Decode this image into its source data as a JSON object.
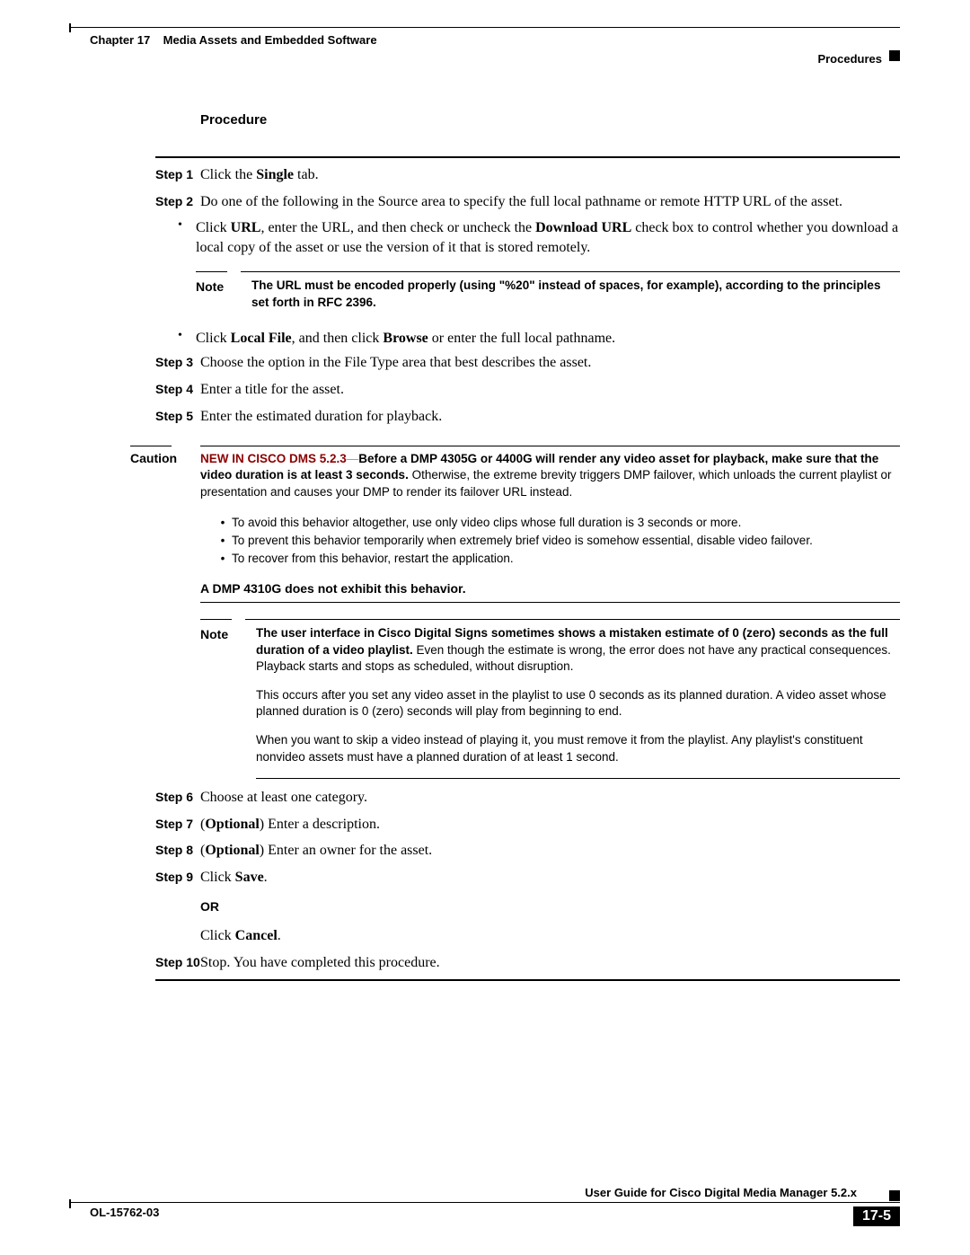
{
  "header": {
    "chapter": "Chapter 17",
    "title": "Media Assets and Embedded Software",
    "section": "Procedures"
  },
  "procedure_title": "Procedure",
  "steps": {
    "s1": {
      "label": "Step 1",
      "t1": "Click the ",
      "b1": "Single",
      "t2": " tab."
    },
    "s2": {
      "label": "Step 2",
      "t1": "Do one of the following in the Source area to specify the full local pathname or remote HTTP URL of the asset."
    },
    "s2_bullet1": {
      "t1": "Click ",
      "b1": "URL",
      "t2": ", enter the URL, and then check or uncheck the ",
      "b2": "Download URL",
      "t3": " check box to control whether you download a local copy of the asset or use the version of it that is stored remotely."
    },
    "s2_bullet2": {
      "t1": "Click ",
      "b1": "Local File",
      "t2": ", and then click ",
      "b2": "Browse",
      "t3": " or enter the full local pathname."
    },
    "s3": {
      "label": "Step 3",
      "text": "Choose the option in the File Type area that best describes the asset."
    },
    "s4": {
      "label": "Step 4",
      "text": "Enter a title for the asset."
    },
    "s5": {
      "label": "Step 5",
      "text": "Enter the estimated duration for playback."
    },
    "s6": {
      "label": "Step 6",
      "text": "Choose at least one category."
    },
    "s7": {
      "label": "Step 7",
      "t1": "(",
      "b1": "Optional",
      "t2": ") Enter a description."
    },
    "s8": {
      "label": "Step 8",
      "t1": "(",
      "b1": "Optional",
      "t2": ") Enter an owner for the asset."
    },
    "s9": {
      "label": "Step 9",
      "t1": "Click ",
      "b1": "Save",
      "t2": "."
    },
    "s9_or": "OR",
    "s9_cancel": {
      "t1": "Click ",
      "b1": "Cancel",
      "t2": "."
    },
    "s10": {
      "label": "Step 10",
      "text": "Stop. You have completed this procedure."
    }
  },
  "note1": {
    "label": "Note",
    "b1": "The URL must be encoded properly (using \"%20\" instead of spaces, for example), according to the principles set forth in RFC 2396."
  },
  "caution": {
    "label": "Caution",
    "red": "NEW IN CISCO DMS 5.2.3",
    "sep": "—",
    "b1": "Before a DMP 4305G or 4400G will render any video asset for playback, make sure that the video duration is at least 3 seconds.",
    "t1": " Otherwise, the extreme brevity triggers DMP failover, which unloads the current playlist or presentation and causes your DMP to render its failover URL instead.",
    "bullets": [
      "To avoid this behavior altogether, use only video clips whose full duration is 3 seconds or more.",
      "To prevent this behavior temporarily when extremely brief video is somehow essential, disable video failover.",
      "To recover from this behavior, restart the application."
    ],
    "closing": "A DMP 4310G does not exhibit this behavior."
  },
  "note2": {
    "label": "Note",
    "b1": "The user interface in Cisco Digital Signs sometimes shows a mistaken estimate of 0 (zero) seconds as the full duration of a video playlist.",
    "t1": " Even though the estimate is wrong, the error does not have any practical consequences. Playback starts and stops as scheduled, without disruption.",
    "p2": "This occurs after you set any video asset in the playlist to use 0 seconds as its planned duration. A video asset whose planned duration is 0 (zero) seconds will play from beginning to end.",
    "p3": "When you want to skip a video instead of playing it, you must remove it from the playlist. Any playlist's constituent nonvideo assets must have a planned duration of at least 1 second."
  },
  "footer": {
    "guide": "User Guide for Cisco Digital Media Manager 5.2.x",
    "doc": "OL-15762-03",
    "page": "17-5"
  }
}
